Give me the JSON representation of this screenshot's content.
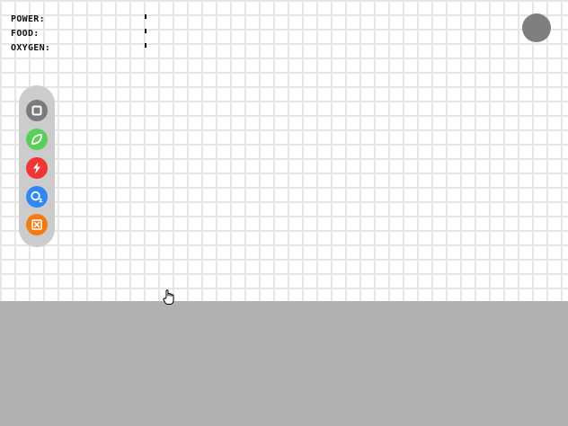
{
  "hud": {
    "stats": [
      {
        "label": "POWER:",
        "level": 0
      },
      {
        "label": "FOOD:",
        "level": 0
      },
      {
        "label": "OXYGEN:",
        "level": 0
      }
    ],
    "menu_icon": "menu-circle-icon"
  },
  "toolbar": {
    "tools": [
      {
        "name": "build",
        "icon": "build-block-icon",
        "color": "#7b7b7b"
      },
      {
        "name": "food",
        "icon": "leaf-icon",
        "color": "#59cf59"
      },
      {
        "name": "power",
        "icon": "lightning-icon",
        "color": "#f03535"
      },
      {
        "name": "oxygen",
        "icon": "oxygen-o2-icon",
        "color": "#2f86f5"
      },
      {
        "name": "demolish",
        "icon": "demolish-icon",
        "color": "#f47b10"
      }
    ]
  },
  "colors": {
    "grid_line": "#e6e6e6",
    "ground": "#b1b1b1",
    "toolbar_bg": "#cccccc",
    "menu_button": "#7f7f7f"
  },
  "cursor_icon": "hand-pointer-icon"
}
